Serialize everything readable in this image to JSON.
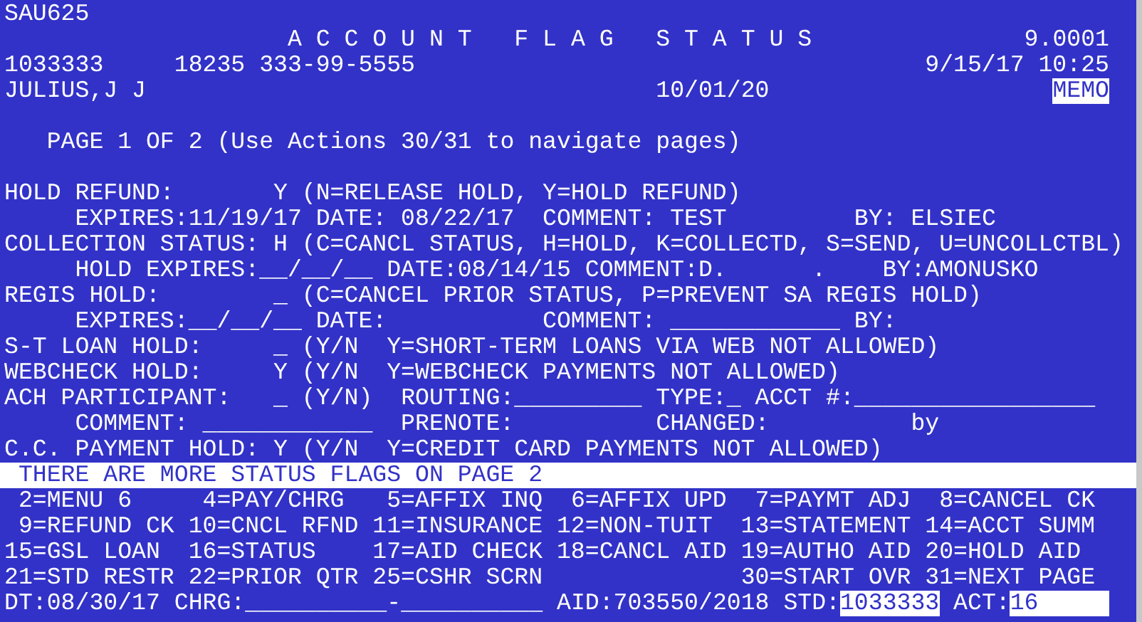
{
  "lines": [
    {
      "kind": "normal",
      "items": [
        {
          "text": "SAU625",
          "kind": "label"
        }
      ]
    },
    {
      "kind": "normal",
      "items": [
        {
          "text": "A C C O U N T   F L A G   S T A T U S",
          "kind": "title"
        },
        {
          "text": "9.0001",
          "kind": "value"
        }
      ]
    },
    {
      "kind": "normal",
      "items": [
        {
          "text": "1033333",
          "kind": "value"
        },
        {
          "text": "18235 333-99-5555",
          "kind": "value"
        },
        {
          "text": "9/15/17 10:25",
          "kind": "value"
        }
      ]
    },
    {
      "kind": "normal",
      "items": [
        {
          "text": "JULIUS,J J",
          "kind": "value"
        },
        {
          "text": "10/01/20",
          "kind": "value"
        },
        {
          "text": "MEMO",
          "kind": "highlight"
        }
      ]
    },
    {
      "kind": "blank"
    },
    {
      "kind": "normal",
      "items": [
        {
          "text": "PAGE 1 OF 2 (Use Actions 30/31 to navigate pages)",
          "kind": "hint"
        }
      ]
    },
    {
      "kind": "blank"
    },
    {
      "kind": "normal",
      "items": [
        {
          "text": "HOLD REFUND:",
          "kind": "label"
        },
        {
          "text": "Y",
          "kind": "value"
        },
        {
          "text": "(N=RELEASE HOLD, Y=HOLD REFUND)",
          "kind": "hint"
        }
      ]
    },
    {
      "kind": "normal",
      "items": [
        {
          "text": "EXPIRES:11/19/17",
          "kind": "label"
        },
        {
          "text": "DATE: 08/22/17",
          "kind": "label"
        },
        {
          "text": "COMMENT: TEST",
          "kind": "label"
        },
        {
          "text": "BY: ELSIEC",
          "kind": "label"
        }
      ]
    },
    {
      "kind": "normal",
      "items": [
        {
          "text": "COLLECTION STATUS:",
          "kind": "label"
        },
        {
          "text": "H",
          "kind": "value"
        },
        {
          "text": "(C=CANCL STATUS, H=HOLD, K=COLLECTD, S=SEND, U=UNCOLLCTBL)",
          "kind": "hint"
        }
      ]
    },
    {
      "kind": "normal",
      "items": [
        {
          "text": "HOLD EXPIRES:__/__/__",
          "kind": "label"
        },
        {
          "text": "DATE:08/14/15",
          "kind": "label"
        },
        {
          "text": "COMMENT:D.",
          "kind": "label"
        },
        {
          "text": ".",
          "kind": "value"
        },
        {
          "text": "BY:AMONUSKO",
          "kind": "label"
        }
      ]
    },
    {
      "kind": "normal",
      "items": [
        {
          "text": "REGIS HOLD:",
          "kind": "label"
        },
        {
          "text": "_",
          "kind": "blank"
        },
        {
          "text": "(C=CANCEL PRIOR STATUS, P=PREVENT SA REGIS HOLD)",
          "kind": "hint"
        }
      ]
    },
    {
      "kind": "normal",
      "items": [
        {
          "text": "EXPIRES:__/__/__",
          "kind": "label"
        },
        {
          "text": "DATE:",
          "kind": "label"
        },
        {
          "text": "COMMENT:",
          "kind": "label"
        },
        {
          "text": "____________",
          "kind": "blank"
        },
        {
          "text": "BY:",
          "kind": "label"
        }
      ]
    },
    {
      "kind": "normal",
      "items": [
        {
          "text": "S-T LOAN HOLD:",
          "kind": "label"
        },
        {
          "text": "_",
          "kind": "blank"
        },
        {
          "text": "(Y/N  Y=SHORT-TERM LOANS VIA WEB NOT ALLOWED)",
          "kind": "hint"
        }
      ]
    },
    {
      "kind": "normal",
      "items": [
        {
          "text": "WEBCHECK HOLD:",
          "kind": "label"
        },
        {
          "text": "Y",
          "kind": "value"
        },
        {
          "text": "(Y/N  Y=WEBCHECK PAYMENTS NOT ALLOWED)",
          "kind": "hint"
        }
      ]
    },
    {
      "kind": "normal",
      "items": [
        {
          "text": "ACH PARTICIPANT:",
          "kind": "label"
        },
        {
          "text": "_",
          "kind": "blank"
        },
        {
          "text": "(Y/N)",
          "kind": "hint"
        },
        {
          "text": "ROUTING:",
          "kind": "label"
        },
        {
          "text": "_________",
          "kind": "blank"
        },
        {
          "text": "TYPE:",
          "kind": "label"
        },
        {
          "text": "_",
          "kind": "blank"
        },
        {
          "text": "ACCT #:",
          "kind": "label"
        },
        {
          "text": "_________________",
          "kind": "blank"
        }
      ]
    },
    {
      "kind": "normal",
      "items": [
        {
          "text": "COMMENT:",
          "kind": "label"
        },
        {
          "text": "____________",
          "kind": "blank"
        },
        {
          "text": "PRENOTE:",
          "kind": "label"
        },
        {
          "text": "CHANGED:",
          "kind": "label"
        },
        {
          "text": "by",
          "kind": "label"
        }
      ]
    },
    {
      "kind": "normal",
      "items": [
        {
          "text": "C.C. PAYMENT HOLD:",
          "kind": "label"
        },
        {
          "text": "Y",
          "kind": "value"
        },
        {
          "text": "(Y/N  Y=CREDIT CARD PAYMENTS NOT ALLOWED)",
          "kind": "hint"
        }
      ]
    },
    {
      "kind": "message",
      "items": [
        {
          "text": "THERE ARE MORE STATUS FLAGS ON PAGE 2",
          "kind": "message"
        }
      ]
    },
    {
      "kind": "normal",
      "items": [
        {
          "text": "2=MENU 6",
          "kind": "action"
        },
        {
          "text": "4=PAY/CHRG",
          "kind": "action"
        },
        {
          "text": "5=AFFIX INQ",
          "kind": "action"
        },
        {
          "text": "6=AFFIX UPD",
          "kind": "action"
        },
        {
          "text": "7=PAYMT ADJ",
          "kind": "action"
        },
        {
          "text": "8=CANCEL CK",
          "kind": "action"
        }
      ]
    },
    {
      "kind": "normal",
      "items": [
        {
          "text": "9=REFUND CK",
          "kind": "action"
        },
        {
          "text": "10=CNCL RFND",
          "kind": "action"
        },
        {
          "text": "11=INSURANCE",
          "kind": "action"
        },
        {
          "text": "12=NON-TUIT",
          "kind": "action"
        },
        {
          "text": "13=STATEMENT",
          "kind": "action"
        },
        {
          "text": "14=ACCT SUMM",
          "kind": "action"
        }
      ]
    },
    {
      "kind": "normal",
      "items": [
        {
          "text": "15=GSL LOAN",
          "kind": "action"
        },
        {
          "text": "16=STATUS",
          "kind": "action"
        },
        {
          "text": "17=AID CHECK",
          "kind": "action"
        },
        {
          "text": "18=CANCL AID",
          "kind": "action"
        },
        {
          "text": "19=AUTHO AID",
          "kind": "action"
        },
        {
          "text": "20=HOLD AID",
          "kind": "action"
        }
      ]
    },
    {
      "kind": "normal",
      "items": [
        {
          "text": "21=STD RESTR",
          "kind": "action"
        },
        {
          "text": "22=PRIOR QTR",
          "kind": "action"
        },
        {
          "text": "25=CSHR SCRN",
          "kind": "action"
        },
        {
          "text": "30=START OVR",
          "kind": "action"
        },
        {
          "text": "31=NEXT PAGE",
          "kind": "action"
        }
      ]
    },
    {
      "kind": "normal",
      "items": [
        {
          "text": "DT:08/30/17",
          "kind": "label"
        },
        {
          "text": "CHRG:",
          "kind": "label"
        },
        {
          "text": "__________",
          "kind": "blank"
        },
        {
          "text": "-",
          "kind": "label"
        },
        {
          "text": "__________",
          "kind": "blank"
        },
        {
          "text": "AID:703550/2018",
          "kind": "label"
        },
        {
          "text": "STD:",
          "kind": "label"
        },
        {
          "text": "1033333",
          "kind": "input"
        },
        {
          "text": "ACT:",
          "kind": "label"
        },
        {
          "text": "16",
          "kind": "input"
        }
      ]
    }
  ]
}
